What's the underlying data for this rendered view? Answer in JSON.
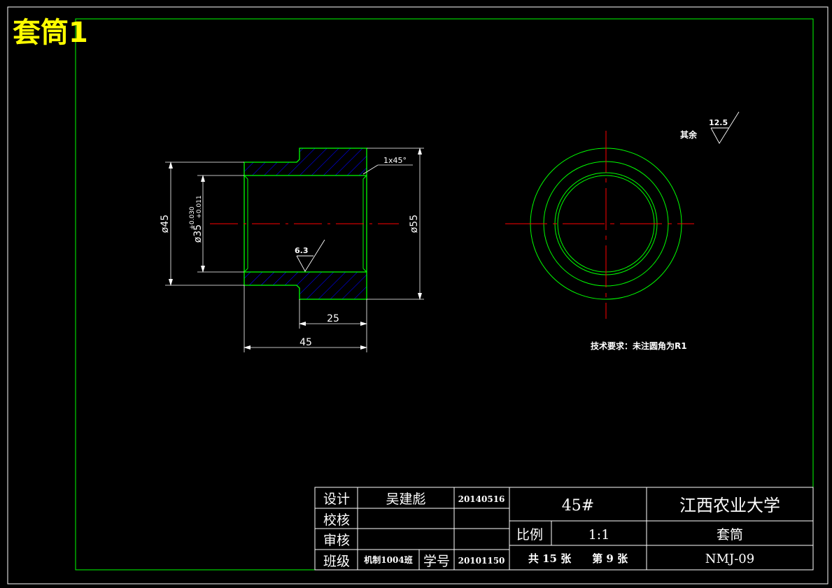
{
  "sheet_title": "套筒1",
  "colors": {
    "background": "#000000",
    "border": "#ffffff",
    "frame": "#00ff00",
    "outline": "#00ff00",
    "hatch": "#0000ff",
    "centerline": "#ff0000",
    "dimension": "#ffffff",
    "title": "#ffff00"
  },
  "drawing": {
    "dims": {
      "d45_left": "ø45",
      "d35_main": "ø35",
      "tol_upper": "+0.030",
      "tol_lower": "+0.011",
      "d55": "ø55",
      "len25": "25",
      "len45": "45",
      "chamfer": "1x45°",
      "roughness_local": "6.3",
      "roughness_other": "12.5",
      "other_label": "其余"
    },
    "tech_req": "技术要求：未注圆角为R1"
  },
  "title_block": {
    "design_label": "设计",
    "designer": "吴建彪",
    "design_date": "20140516",
    "check_label": "校核",
    "review_label": "审核",
    "class_label": "班级",
    "class_value": "机制1004班",
    "student_no_label": "学号",
    "student_no": "20101150",
    "material": "45#",
    "school": "江西农业大学",
    "scale_label": "比例",
    "scale_value": "1:1",
    "part_name": "套筒",
    "sheets": "共 15 张　　第 9 张",
    "drawing_no": "NMJ-09"
  }
}
